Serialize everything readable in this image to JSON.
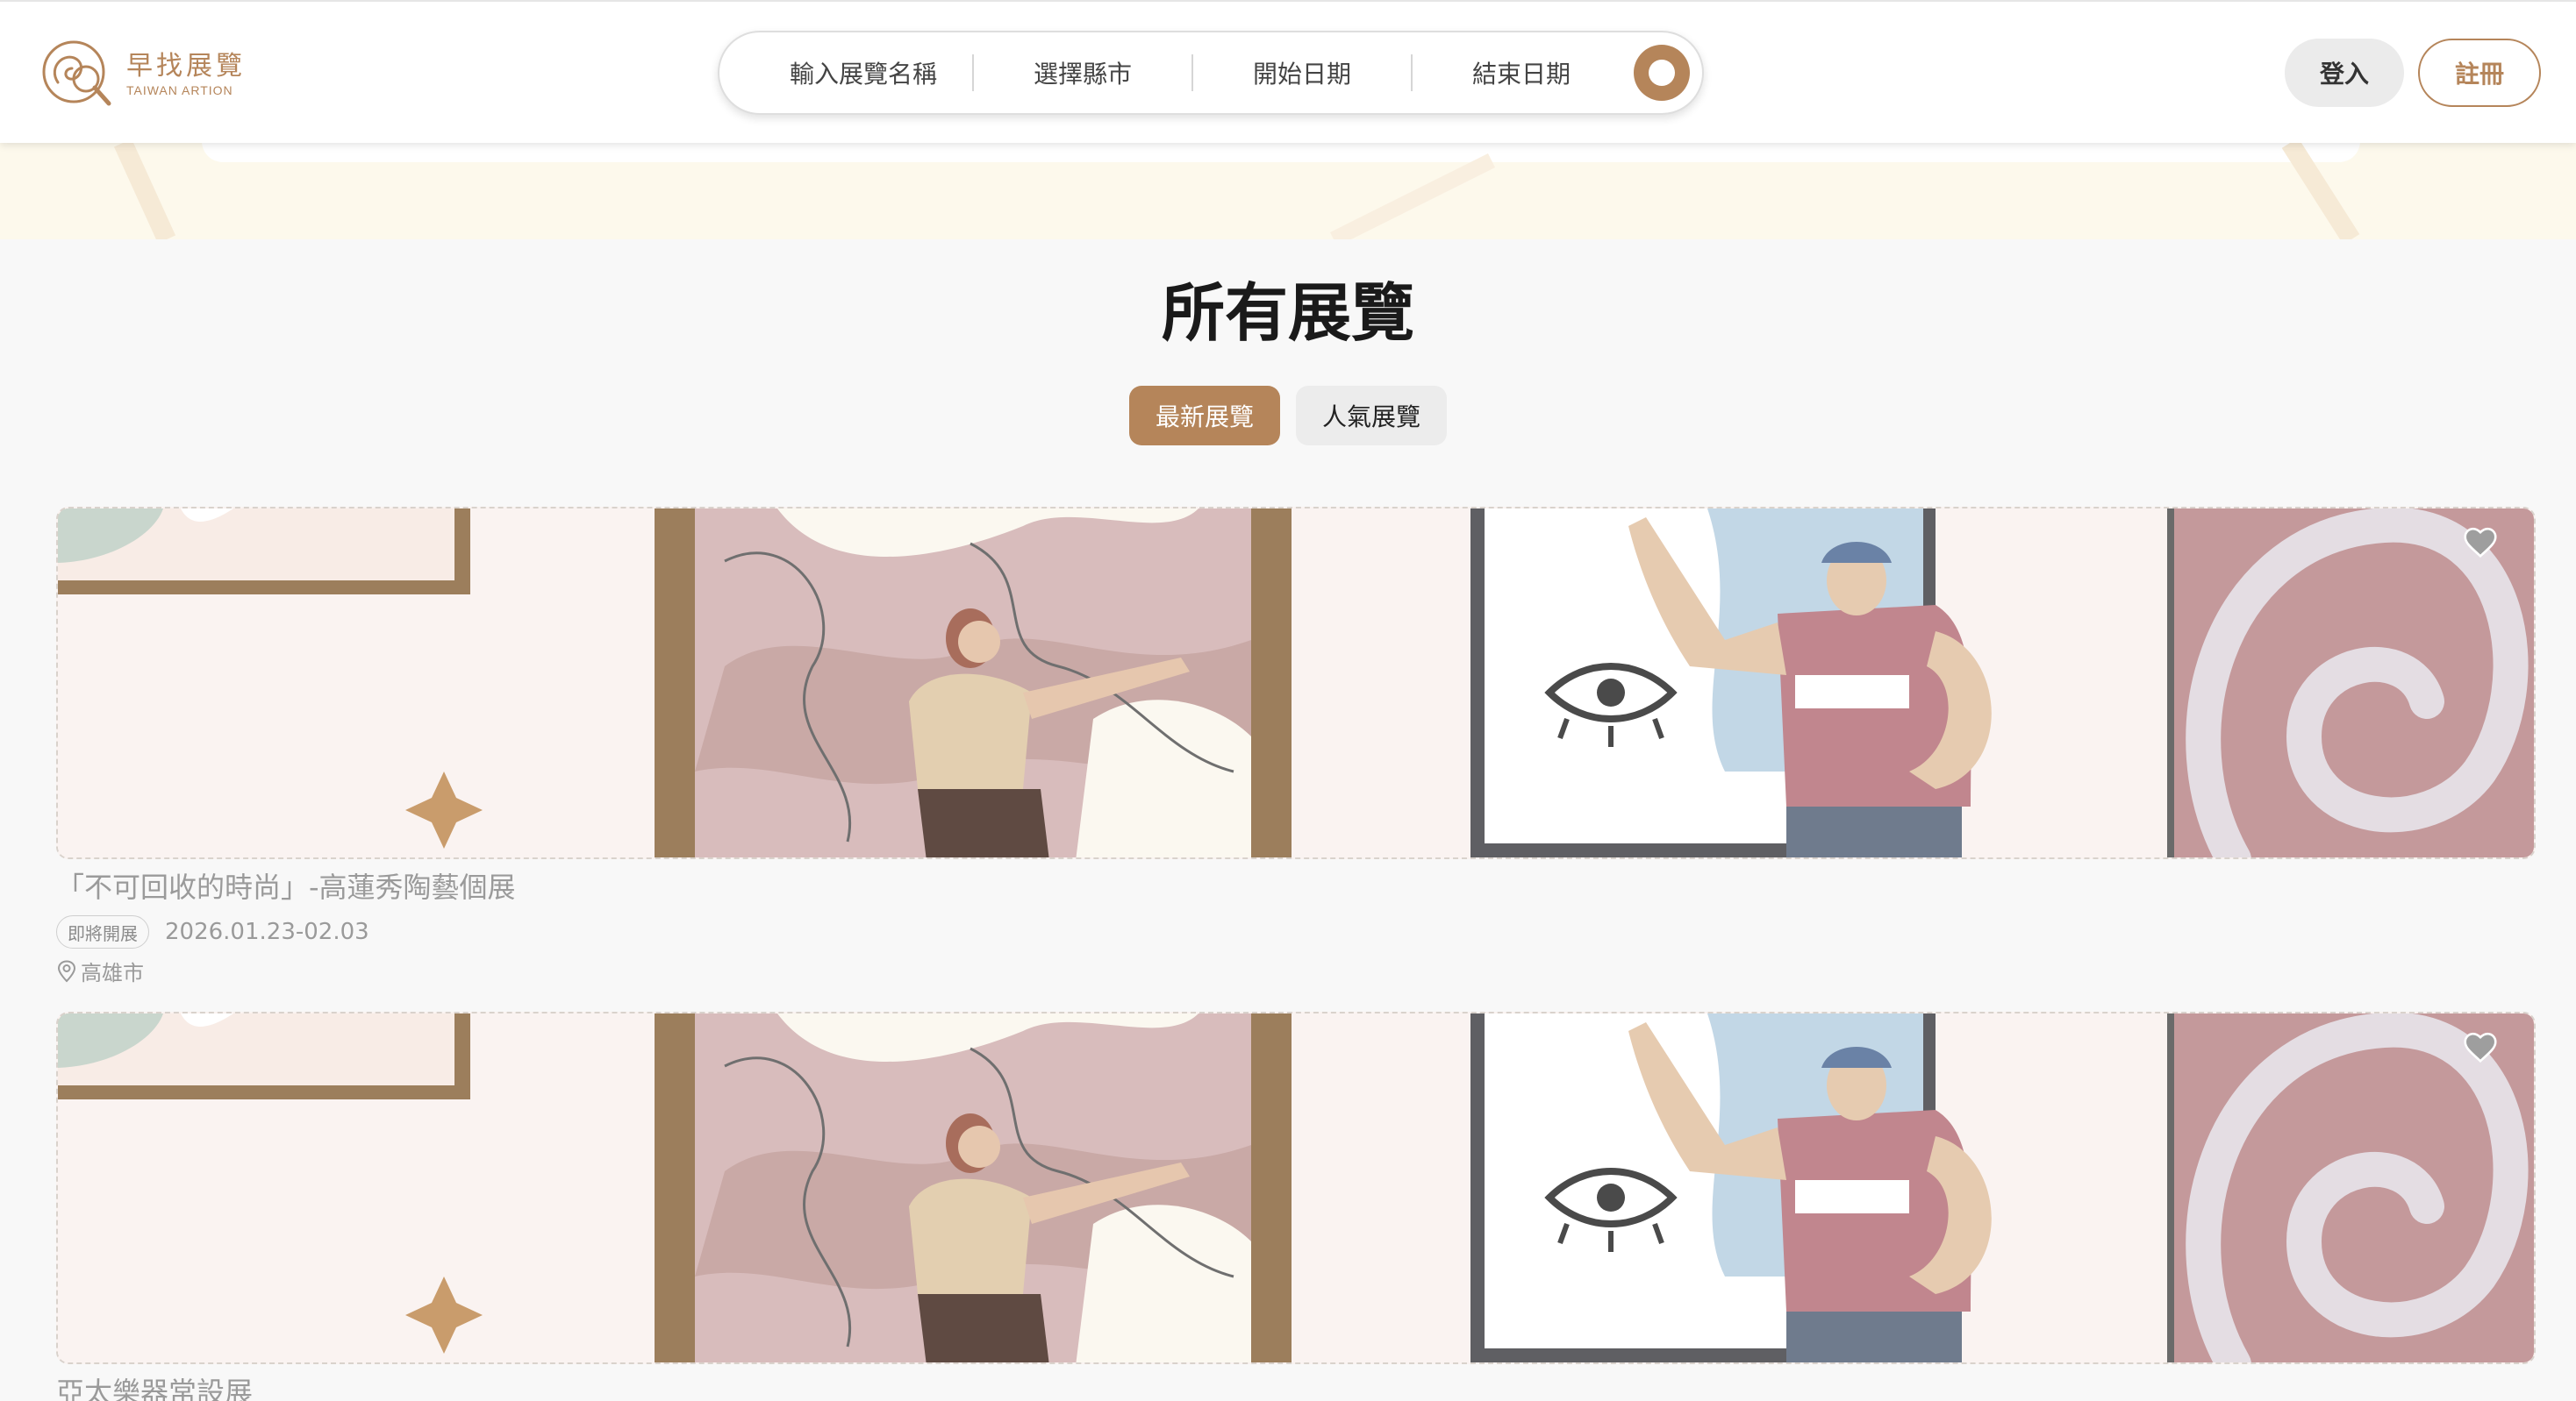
{
  "brand": {
    "name_cn": "早找展覽",
    "name_en": "TAIWAN ARTION",
    "color": "#b5855a"
  },
  "search": {
    "fields": [
      "輸入展覽名稱",
      "選擇縣市",
      "開始日期",
      "結束日期"
    ],
    "button_icon": "search-icon"
  },
  "auth": {
    "login": "登入",
    "register": "註冊"
  },
  "page": {
    "title": "所有展覽"
  },
  "tabs": [
    {
      "label": "最新展覽",
      "active": true
    },
    {
      "label": "人氣展覽",
      "active": false
    }
  ],
  "exhibitions": [
    {
      "title": "「不可回收的時尚」-高蓮秀陶藝個展",
      "status": "即將開展",
      "date": "2026.01.23-02.03",
      "location": "高雄市",
      "favorite_icon": "heart-icon"
    },
    {
      "title": "亞太樂器常設展",
      "favorite_icon": "heart-icon"
    }
  ]
}
